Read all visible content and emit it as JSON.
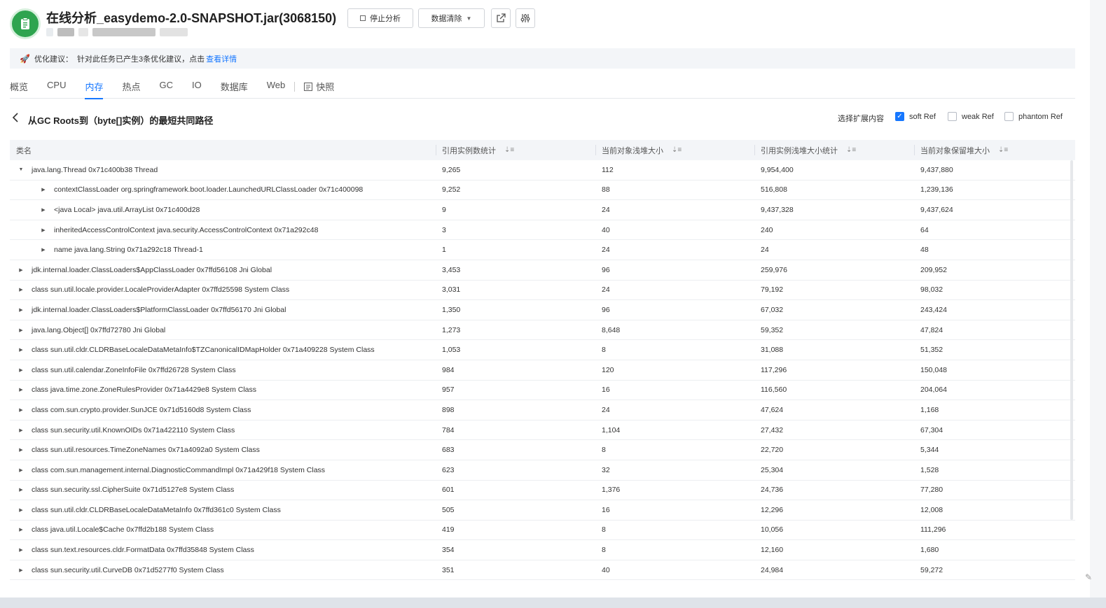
{
  "header": {
    "title": "在线分析_easydemo-2.0-SNAPSHOT.jar(3068150)",
    "stop_label": "停止分析",
    "clear_label": "数据清除"
  },
  "suggestion": {
    "prefix": "优化建议：",
    "text": "针对此任务已产生3条优化建议，点击",
    "link": "查看详情"
  },
  "tabs": [
    "概览",
    "CPU",
    "内存",
    "热点",
    "GC",
    "IO",
    "数据库",
    "Web"
  ],
  "snapshot_tab": "快照",
  "section": {
    "title": "从GC Roots到（byte[]实例）的最短共同路径",
    "ext_label": "选择扩展内容",
    "soft": "soft Ref",
    "weak": "weak Ref",
    "phantom": "phantom Ref"
  },
  "columns": [
    "类名",
    "引用实例数统计",
    "当前对象浅堆大小",
    "引用实例浅堆大小统计",
    "当前对象保留堆大小"
  ],
  "rows": [
    {
      "name": "java.lang.Thread 0x71c400b38 Thread",
      "level": 0,
      "expanded": true,
      "c1": "9,265",
      "c2": "112",
      "c3": "9,954,400",
      "c4": "9,437,880"
    },
    {
      "name": "contextClassLoader org.springframework.boot.loader.LaunchedURLClassLoader 0x71c400098",
      "level": 1,
      "expanded": false,
      "c1": "9,252",
      "c2": "88",
      "c3": "516,808",
      "c4": "1,239,136"
    },
    {
      "name": "<java Local> java.util.ArrayList 0x71c400d28",
      "level": 1,
      "expanded": false,
      "c1": "9",
      "c2": "24",
      "c3": "9,437,328",
      "c4": "9,437,624"
    },
    {
      "name": "inheritedAccessControlContext java.security.AccessControlContext 0x71a292c48",
      "level": 1,
      "expanded": false,
      "c1": "3",
      "c2": "40",
      "c3": "240",
      "c4": "64"
    },
    {
      "name": "name java.lang.String 0x71a292c18 Thread-1",
      "level": 1,
      "expanded": false,
      "c1": "1",
      "c2": "24",
      "c3": "24",
      "c4": "48"
    },
    {
      "name": "jdk.internal.loader.ClassLoaders$AppClassLoader 0x7ffd56108 Jni Global",
      "level": 0,
      "expanded": false,
      "c1": "3,453",
      "c2": "96",
      "c3": "259,976",
      "c4": "209,952"
    },
    {
      "name": "class sun.util.locale.provider.LocaleProviderAdapter 0x7ffd25598 System Class",
      "level": 0,
      "expanded": false,
      "c1": "3,031",
      "c2": "24",
      "c3": "79,192",
      "c4": "98,032"
    },
    {
      "name": "jdk.internal.loader.ClassLoaders$PlatformClassLoader 0x7ffd56170 Jni Global",
      "level": 0,
      "expanded": false,
      "c1": "1,350",
      "c2": "96",
      "c3": "67,032",
      "c4": "243,424"
    },
    {
      "name": "java.lang.Object[] 0x7ffd72780 Jni Global",
      "level": 0,
      "expanded": false,
      "c1": "1,273",
      "c2": "8,648",
      "c3": "59,352",
      "c4": "47,824"
    },
    {
      "name": "class sun.util.cldr.CLDRBaseLocaleDataMetaInfo$TZCanonicalIDMapHolder 0x71a409228 System Class",
      "level": 0,
      "expanded": false,
      "c1": "1,053",
      "c2": "8",
      "c3": "31,088",
      "c4": "51,352"
    },
    {
      "name": "class sun.util.calendar.ZoneInfoFile 0x7ffd26728 System Class",
      "level": 0,
      "expanded": false,
      "c1": "984",
      "c2": "120",
      "c3": "117,296",
      "c4": "150,048"
    },
    {
      "name": "class java.time.zone.ZoneRulesProvider 0x71a4429e8 System Class",
      "level": 0,
      "expanded": false,
      "c1": "957",
      "c2": "16",
      "c3": "116,560",
      "c4": "204,064"
    },
    {
      "name": "class com.sun.crypto.provider.SunJCE 0x71d5160d8 System Class",
      "level": 0,
      "expanded": false,
      "c1": "898",
      "c2": "24",
      "c3": "47,624",
      "c4": "1,168"
    },
    {
      "name": "class sun.security.util.KnownOIDs 0x71a422110 System Class",
      "level": 0,
      "expanded": false,
      "c1": "784",
      "c2": "1,104",
      "c3": "27,432",
      "c4": "67,304"
    },
    {
      "name": "class sun.util.resources.TimeZoneNames 0x71a4092a0 System Class",
      "level": 0,
      "expanded": false,
      "c1": "683",
      "c2": "8",
      "c3": "22,720",
      "c4": "5,344"
    },
    {
      "name": "class com.sun.management.internal.DiagnosticCommandImpl 0x71a429f18 System Class",
      "level": 0,
      "expanded": false,
      "c1": "623",
      "c2": "32",
      "c3": "25,304",
      "c4": "1,528"
    },
    {
      "name": "class sun.security.ssl.CipherSuite 0x71d5127e8 System Class",
      "level": 0,
      "expanded": false,
      "c1": "601",
      "c2": "1,376",
      "c3": "24,736",
      "c4": "77,280"
    },
    {
      "name": "class sun.util.cldr.CLDRBaseLocaleDataMetaInfo 0x7ffd361c0 System Class",
      "level": 0,
      "expanded": false,
      "c1": "505",
      "c2": "16",
      "c3": "12,296",
      "c4": "12,008"
    },
    {
      "name": "class java.util.Locale$Cache 0x7ffd2b188 System Class",
      "level": 0,
      "expanded": false,
      "c1": "419",
      "c2": "8",
      "c3": "10,056",
      "c4": "111,296"
    },
    {
      "name": "class sun.text.resources.cldr.FormatData 0x7ffd35848 System Class",
      "level": 0,
      "expanded": false,
      "c1": "354",
      "c2": "8",
      "c3": "12,160",
      "c4": "1,680"
    },
    {
      "name": "class sun.security.util.CurveDB 0x71d5277f0 System Class",
      "level": 0,
      "expanded": false,
      "c1": "351",
      "c2": "40",
      "c3": "24,984",
      "c4": "59,272"
    }
  ]
}
